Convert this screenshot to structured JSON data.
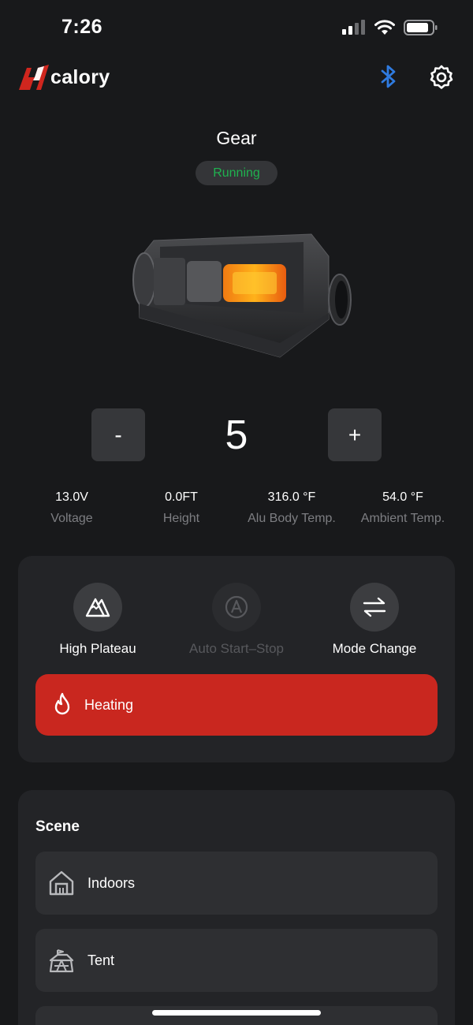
{
  "status_bar": {
    "time": "7:26",
    "icons": [
      "cellular-signal-icon",
      "wifi-icon",
      "battery-icon"
    ]
  },
  "header": {
    "logo_text": "calory",
    "bluetooth_icon": "bluetooth-icon",
    "settings_icon": "gear-icon",
    "accent_color": "#2f7be0"
  },
  "device": {
    "title": "Gear",
    "status": "Running",
    "status_color": "#1fb24f"
  },
  "gear": {
    "minus_label": "-",
    "value": "5",
    "plus_label": "+"
  },
  "metrics": [
    {
      "value": "13.0V",
      "label": "Voltage"
    },
    {
      "value": "0.0FT",
      "label": "Height"
    },
    {
      "value": "316.0 °F",
      "label": "Alu Body Temp."
    },
    {
      "value": "54.0 °F",
      "label": "Ambient Temp."
    }
  ],
  "controls": [
    {
      "label": "High Plateau",
      "icon": "mountain-icon",
      "enabled": true
    },
    {
      "label": "Auto Start–Stop",
      "icon": "auto-a-icon",
      "enabled": false
    },
    {
      "label": "Mode Change",
      "icon": "swap-arrows-icon",
      "enabled": true
    }
  ],
  "heating": {
    "label": "Heating",
    "icon": "flame-icon",
    "color": "#c9271f"
  },
  "scene": {
    "title": "Scene",
    "items": [
      {
        "label": "Indoors",
        "icon": "house-icon"
      },
      {
        "label": "Tent",
        "icon": "tent-icon"
      }
    ]
  }
}
